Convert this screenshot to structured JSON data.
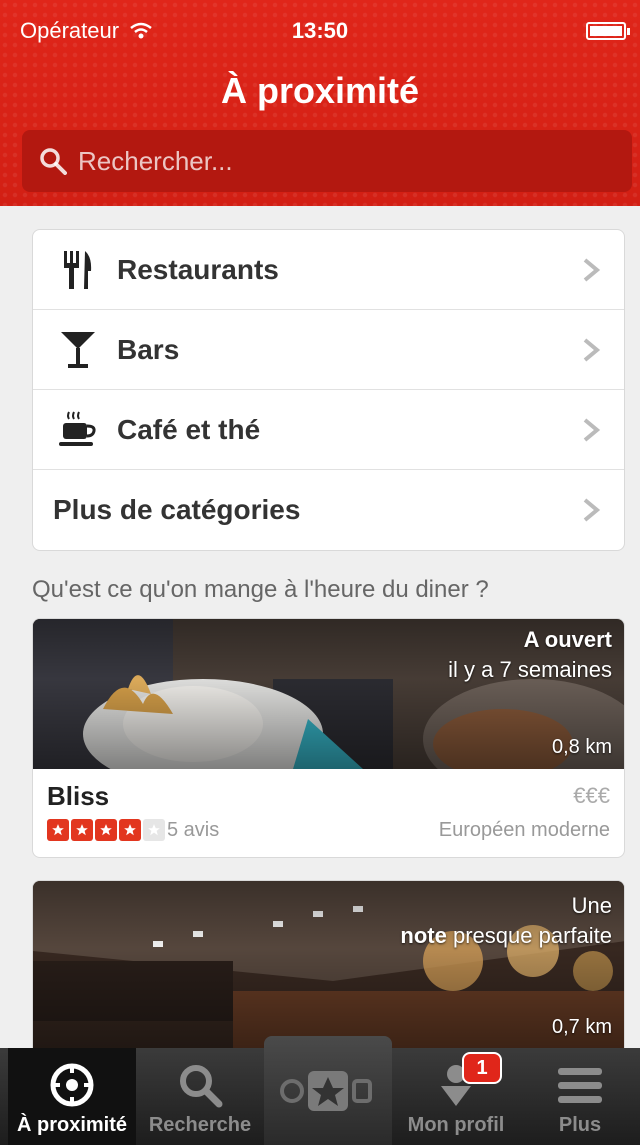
{
  "status_bar": {
    "carrier": "Opérateur",
    "time": "13:50"
  },
  "header": {
    "title": "À proximité"
  },
  "search": {
    "placeholder": "Rechercher..."
  },
  "categories": [
    {
      "label": "Restaurants",
      "icon": "fork-knife-icon"
    },
    {
      "label": "Bars",
      "icon": "cocktail-glass-icon"
    },
    {
      "label": "Café et thé",
      "icon": "coffee-cup-icon"
    },
    {
      "label": "Plus de catégories"
    }
  ],
  "section_title": "Qu'est ce qu'on mange à l'heure du diner ?",
  "cards": [
    {
      "overlay_line1": "A ouvert",
      "overlay_line2": "il y a 7 semaines",
      "distance": "0,8 km",
      "name": "Bliss",
      "price": "€€€",
      "rating": 4,
      "rating_max": 5,
      "reviews": "5 avis",
      "cuisine": "Européen moderne"
    },
    {
      "overlay_line1": "Une",
      "overlay_line2_bold": "note",
      "overlay_line2_rest": "presque parfaite",
      "distance": "0,7 km"
    }
  ],
  "tabbar": {
    "tabs": [
      {
        "label": "À proximité",
        "icon": "compass-icon"
      },
      {
        "label": "Recherche",
        "icon": "search-icon"
      },
      {
        "label": "",
        "icon": "camera-star-icon"
      },
      {
        "label": "Mon profil",
        "icon": "profile-icon"
      },
      {
        "label": "Plus",
        "icon": "menu-icon"
      }
    ],
    "profile_badge": "1"
  },
  "colors": {
    "brand_red": "#d32323",
    "tab_bg": "#1d1d1d"
  }
}
